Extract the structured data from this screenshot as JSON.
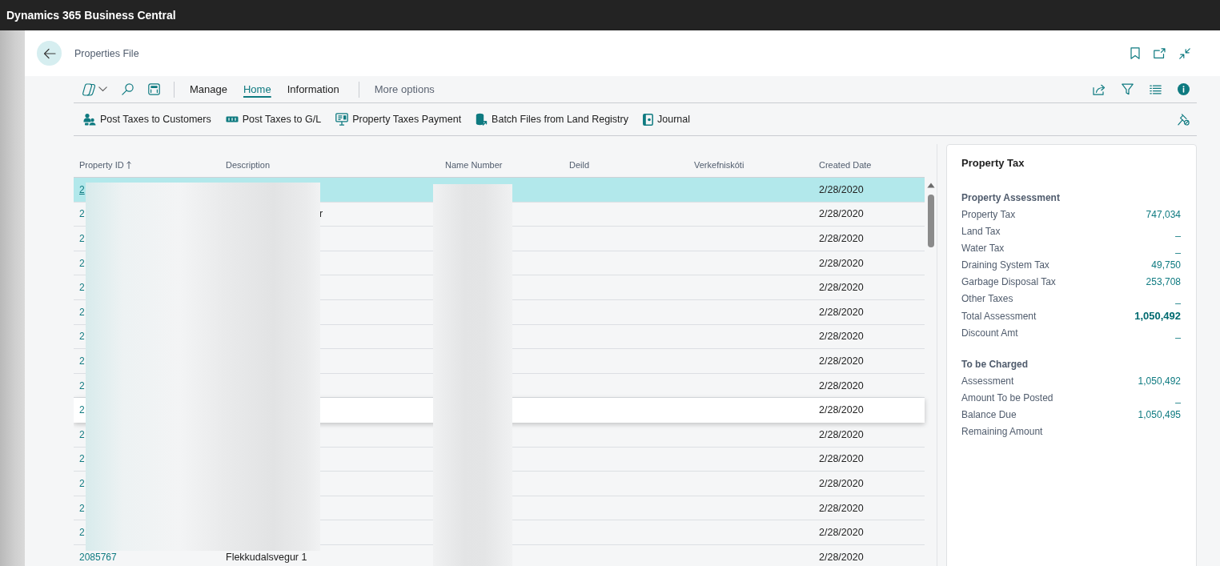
{
  "app_bar": {
    "title": "Dynamics 365 Business Central"
  },
  "page": {
    "title": "Properties File"
  },
  "action_bar": {
    "tabs": [
      {
        "label": "Manage",
        "selected": false
      },
      {
        "label": "Home",
        "selected": true
      },
      {
        "label": "Information",
        "selected": false
      }
    ],
    "more_options": "More options"
  },
  "actions": [
    {
      "label": "Post Taxes to Customers"
    },
    {
      "label": "Post Taxes to G/L"
    },
    {
      "label": "Property Taxes Payment"
    },
    {
      "label": "Batch Files from Land Registry"
    },
    {
      "label": "Journal"
    }
  ],
  "table": {
    "columns": [
      {
        "label": "Property ID",
        "sorted": true
      },
      {
        "label": "Description",
        "sorted": false
      },
      {
        "label": "Name Number",
        "sorted": false
      },
      {
        "label": "Deild",
        "sorted": false
      },
      {
        "label": "Verkefniskóti",
        "sorted": false
      },
      {
        "label": "Created Date",
        "sorted": false
      }
    ],
    "rows": [
      {
        "property_id": "2",
        "created_date": "2/28/2020",
        "selected": true,
        "hovered": false
      },
      {
        "property_id": "2",
        "description": "r",
        "created_date": "2/28/2020",
        "selected": false,
        "hovered": false
      },
      {
        "property_id": "2",
        "created_date": "2/28/2020",
        "selected": false,
        "hovered": false
      },
      {
        "property_id": "2",
        "created_date": "2/28/2020",
        "selected": false,
        "hovered": false
      },
      {
        "property_id": "2",
        "created_date": "2/28/2020",
        "selected": false,
        "hovered": false
      },
      {
        "property_id": "2",
        "created_date": "2/28/2020",
        "selected": false,
        "hovered": false
      },
      {
        "property_id": "2",
        "created_date": "2/28/2020",
        "selected": false,
        "hovered": false
      },
      {
        "property_id": "2",
        "created_date": "2/28/2020",
        "selected": false,
        "hovered": false
      },
      {
        "property_id": "2",
        "created_date": "2/28/2020",
        "selected": false,
        "hovered": false
      },
      {
        "property_id": "2",
        "created_date": "2/28/2020",
        "selected": false,
        "hovered": true
      },
      {
        "property_id": "2",
        "created_date": "2/28/2020",
        "selected": false,
        "hovered": false
      },
      {
        "property_id": "2",
        "created_date": "2/28/2020",
        "selected": false,
        "hovered": false
      },
      {
        "property_id": "2",
        "created_date": "2/28/2020",
        "selected": false,
        "hovered": false
      },
      {
        "property_id": "2",
        "created_date": "2/28/2020",
        "selected": false,
        "hovered": false
      },
      {
        "property_id": "2",
        "created_date": "2/28/2020",
        "selected": false,
        "hovered": false
      },
      {
        "property_id": "2085767",
        "description": "Flekkudalsvegur 1",
        "created_date": "2/28/2020",
        "selected": false,
        "hovered": false
      }
    ]
  },
  "factbox": {
    "title": "Property Tax",
    "sections": [
      {
        "heading": "Property Assessment",
        "fields": [
          {
            "label": "Property Tax",
            "value": "747,034",
            "total": false
          },
          {
            "label": "Land Tax",
            "value": "_",
            "total": false
          },
          {
            "label": "Water Tax",
            "value": "_",
            "total": false
          },
          {
            "label": "Draining System Tax",
            "value": "49,750",
            "total": false
          },
          {
            "label": "Garbage Disposal Tax",
            "value": "253,708",
            "total": false
          },
          {
            "label": "Other Taxes",
            "value": "_",
            "total": false
          },
          {
            "label": "Total Assessment",
            "value": "1,050,492",
            "total": true
          },
          {
            "label": "Discount Amt",
            "value": "_",
            "total": false
          }
        ]
      },
      {
        "heading": "To be Charged",
        "fields": [
          {
            "label": "Assessment",
            "value": "1,050,492",
            "total": false
          },
          {
            "label": "Amount To be Posted",
            "value": "_",
            "total": false
          },
          {
            "label": "Balance Due",
            "value": "1,050,495",
            "total": false
          },
          {
            "label": "Remaining Amount"
          }
        ]
      }
    ]
  }
}
